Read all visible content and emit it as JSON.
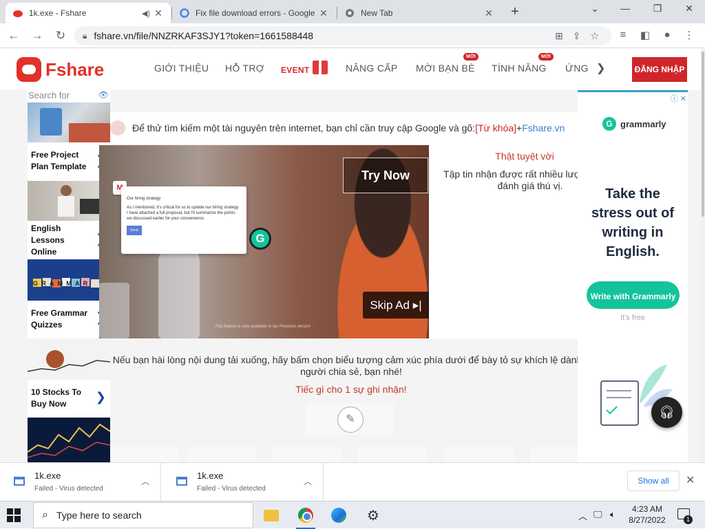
{
  "browser": {
    "tabs": [
      {
        "title": "1k.exe - Fshare",
        "audio": "speaker-icon"
      },
      {
        "title": "Fix file download errors - Google"
      },
      {
        "title": "New Tab"
      }
    ],
    "url": "fshare.vn/file/NNZRKAF3SJY1?token=1661588448"
  },
  "site": {
    "logo": "Fshare",
    "menu": [
      "GIỚI THIỆU",
      "HỖ TRỢ",
      "EVENT",
      "NÂNG CẤP",
      "MỜI BẠN BÈ",
      "TÍNH NĂNG",
      "ỨNG"
    ],
    "badge": "MỚI",
    "login": "ĐĂNG NHẬP"
  },
  "left_ads": {
    "search_placeholder": "Search for",
    "items": [
      "Free Project\nPlan Template",
      "English\nLessons\nOnline",
      "Free Grammar\nQuizzes",
      "10 Stocks To\nBuy Now"
    ],
    "grammar_tiles": "GRAMMAR"
  },
  "content": {
    "tip_text": "Để thử tìm kiếm một tài nguyên trên internet, bạn chỉ cần truy cập Google và gõ: ",
    "tip_keyword": "[Từ khóa]",
    "tip_plus": " + ",
    "tip_site": "Fshare.vn",
    "great": "Thật tuyệt vời",
    "received": "Tập tin nhận được rất nhiều lượ thích và đánh giá thú vị.",
    "thanks": "Nếu bạn hài lòng nội dung tải xuống, hãy bấm chọn biểu tượng cảm xúc phía dưới để bày tỏ sự khích lệ dành c người chia sẻ, bạn nhé!",
    "recognize": "Tiếc gì cho 1 sự ghi nhận!"
  },
  "video_ad": {
    "try_now": "Try Now",
    "skip_ad": "Skip Ad ▸|",
    "mail_title": "Our hiring strategy",
    "mail_body": "As I mentioned, it's critical for us to update our hiring strategy. I have attached a full proposal, but I'll summarize the points we discussed earlier for your convenience.",
    "mail_send": "Send",
    "disclaimer": "This feature is only available in our Premium version"
  },
  "right_ad": {
    "brand": "grammarly",
    "headline": "Take the stress out of writing in English.",
    "cta": "Write with Grammarly",
    "free": "It's free"
  },
  "downloads": [
    {
      "name": "1k.exe",
      "status": "Failed - Virus detected"
    },
    {
      "name": "1k.exe",
      "status": "Failed - Virus detected"
    }
  ],
  "download_bar": {
    "show_all": "Show all"
  },
  "taskbar": {
    "search_placeholder": "Type here to search",
    "time": "4:23 AM",
    "date": "8/27/2022",
    "notifications": "1"
  }
}
